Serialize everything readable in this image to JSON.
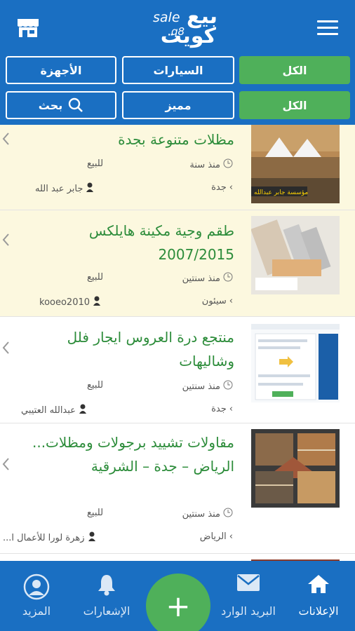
{
  "header": {
    "logo_latin": "sale",
    "logo_q8": "q8",
    "logo_ar_line1": "بيع",
    "logo_ar_line2": "كويت"
  },
  "filters": {
    "row1": [
      "الكل",
      "السيارات",
      "الأجهزة"
    ],
    "row2": [
      "الكل",
      "مميز",
      "بحث"
    ]
  },
  "listings": [
    {
      "title": "مظلات متنوعة بجدة",
      "time": "منذ سنة",
      "type": "للبيع",
      "city": "جدة",
      "user": "جابر عبد الله",
      "featured": true
    },
    {
      "title": "طقم وجية مكينة هايلكس 2007/2015",
      "time": "منذ سنتين",
      "type": "للبيع",
      "city": "سيئون",
      "user": "kooeo2010",
      "featured": true
    },
    {
      "title": "منتجع درة العروس ايجار فلل وشاليهات",
      "time": "منذ سنتين",
      "type": "للبيع",
      "city": "جدة",
      "user": "عبدالله العتيبي",
      "featured": false
    },
    {
      "title": "مقاولات تشييد برجولات ومظلات... الرياض – جدة – الشرقية",
      "time": "منذ سنتين",
      "type": "للبيع",
      "city": "الرياض",
      "user": "زهرة لورا للأعمال ا...",
      "featured": false
    }
  ],
  "thumb_text": {
    "t1": "مؤسسة جابر عبدالله"
  },
  "bottom_nav": {
    "ads": "الإعلانات",
    "inbox": "البريد الوارد",
    "notifications": "الإشعارات",
    "more": "المزيد",
    "add": "+"
  },
  "colors": {
    "primary": "#1a6fc2",
    "accent_green": "#4fb05a",
    "featured_bg": "#fcf8df",
    "title_green": "#2c8c3a"
  }
}
